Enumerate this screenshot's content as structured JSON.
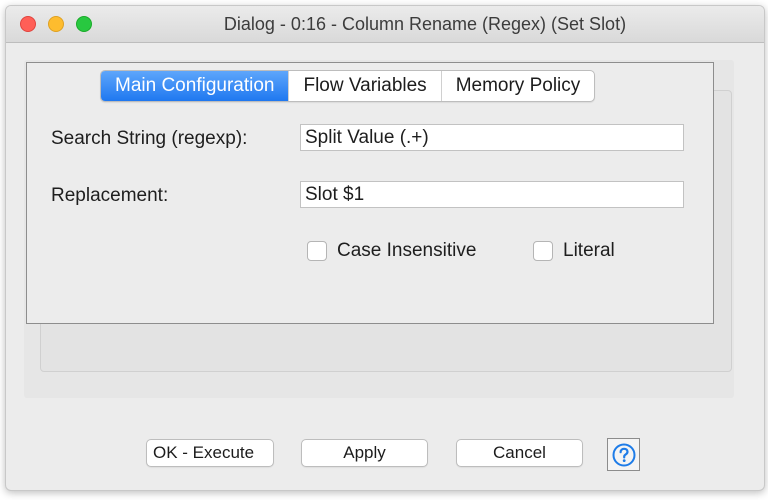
{
  "window": {
    "title": "Dialog - 0:16 - Column Rename (Regex) (Set Slot)"
  },
  "tabs": [
    {
      "label": "Main Configuration",
      "active": true
    },
    {
      "label": "Flow Variables",
      "active": false
    },
    {
      "label": "Memory Policy",
      "active": false
    }
  ],
  "form": {
    "search_label": "Search String (regexp):",
    "search_value": "Split Value (.+)",
    "replacement_label": "Replacement:",
    "replacement_value": "Slot $1",
    "case_insensitive_label": "Case Insensitive",
    "case_insensitive_checked": false,
    "literal_label": "Literal",
    "literal_checked": false
  },
  "buttons": {
    "ok_label": "OK - Execute",
    "apply_label": "Apply",
    "cancel_label": "Cancel"
  },
  "icons": {
    "close": "close-icon",
    "minimize": "minimize-icon",
    "maximize": "maximize-icon",
    "help": "help-icon"
  },
  "colors": {
    "active_tab": "#1f78f0",
    "help_icon": "#1e7ce8",
    "close": "#ff5f57",
    "minimize": "#febc2e",
    "maximize": "#28c840"
  }
}
